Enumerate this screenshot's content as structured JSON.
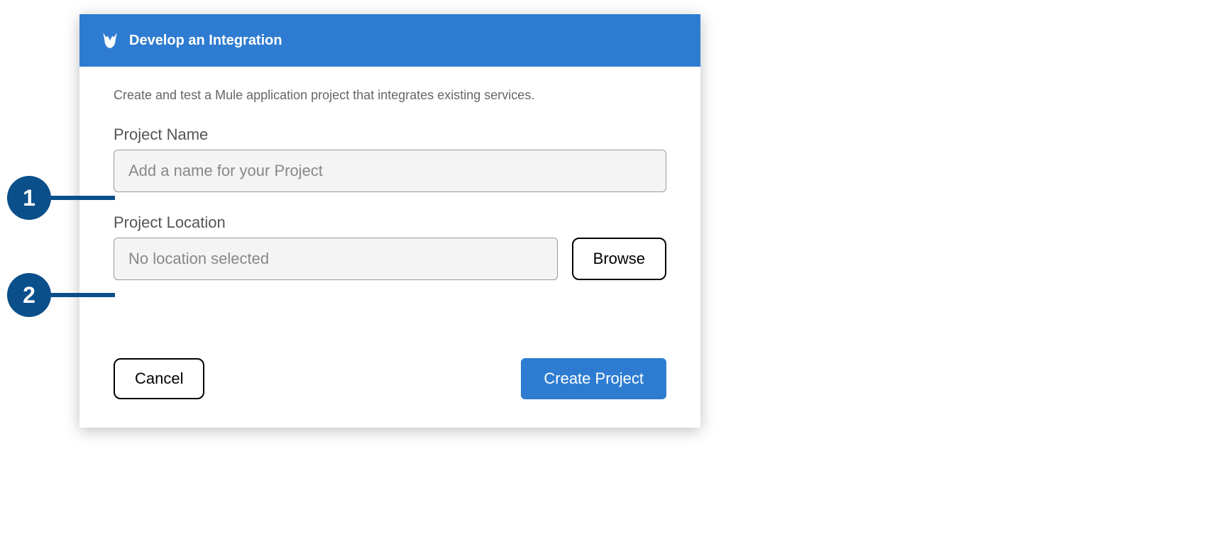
{
  "dialog": {
    "title": "Develop an Integration",
    "description": "Create and test a Mule application project that integrates existing services.",
    "projectName": {
      "label": "Project Name",
      "placeholder": "Add a name for your Project",
      "value": ""
    },
    "projectLocation": {
      "label": "Project Location",
      "placeholder": "No location selected",
      "value": "",
      "browseLabel": "Browse"
    },
    "buttons": {
      "cancel": "Cancel",
      "create": "Create Project"
    }
  },
  "callouts": {
    "one": "1",
    "two": "2"
  }
}
